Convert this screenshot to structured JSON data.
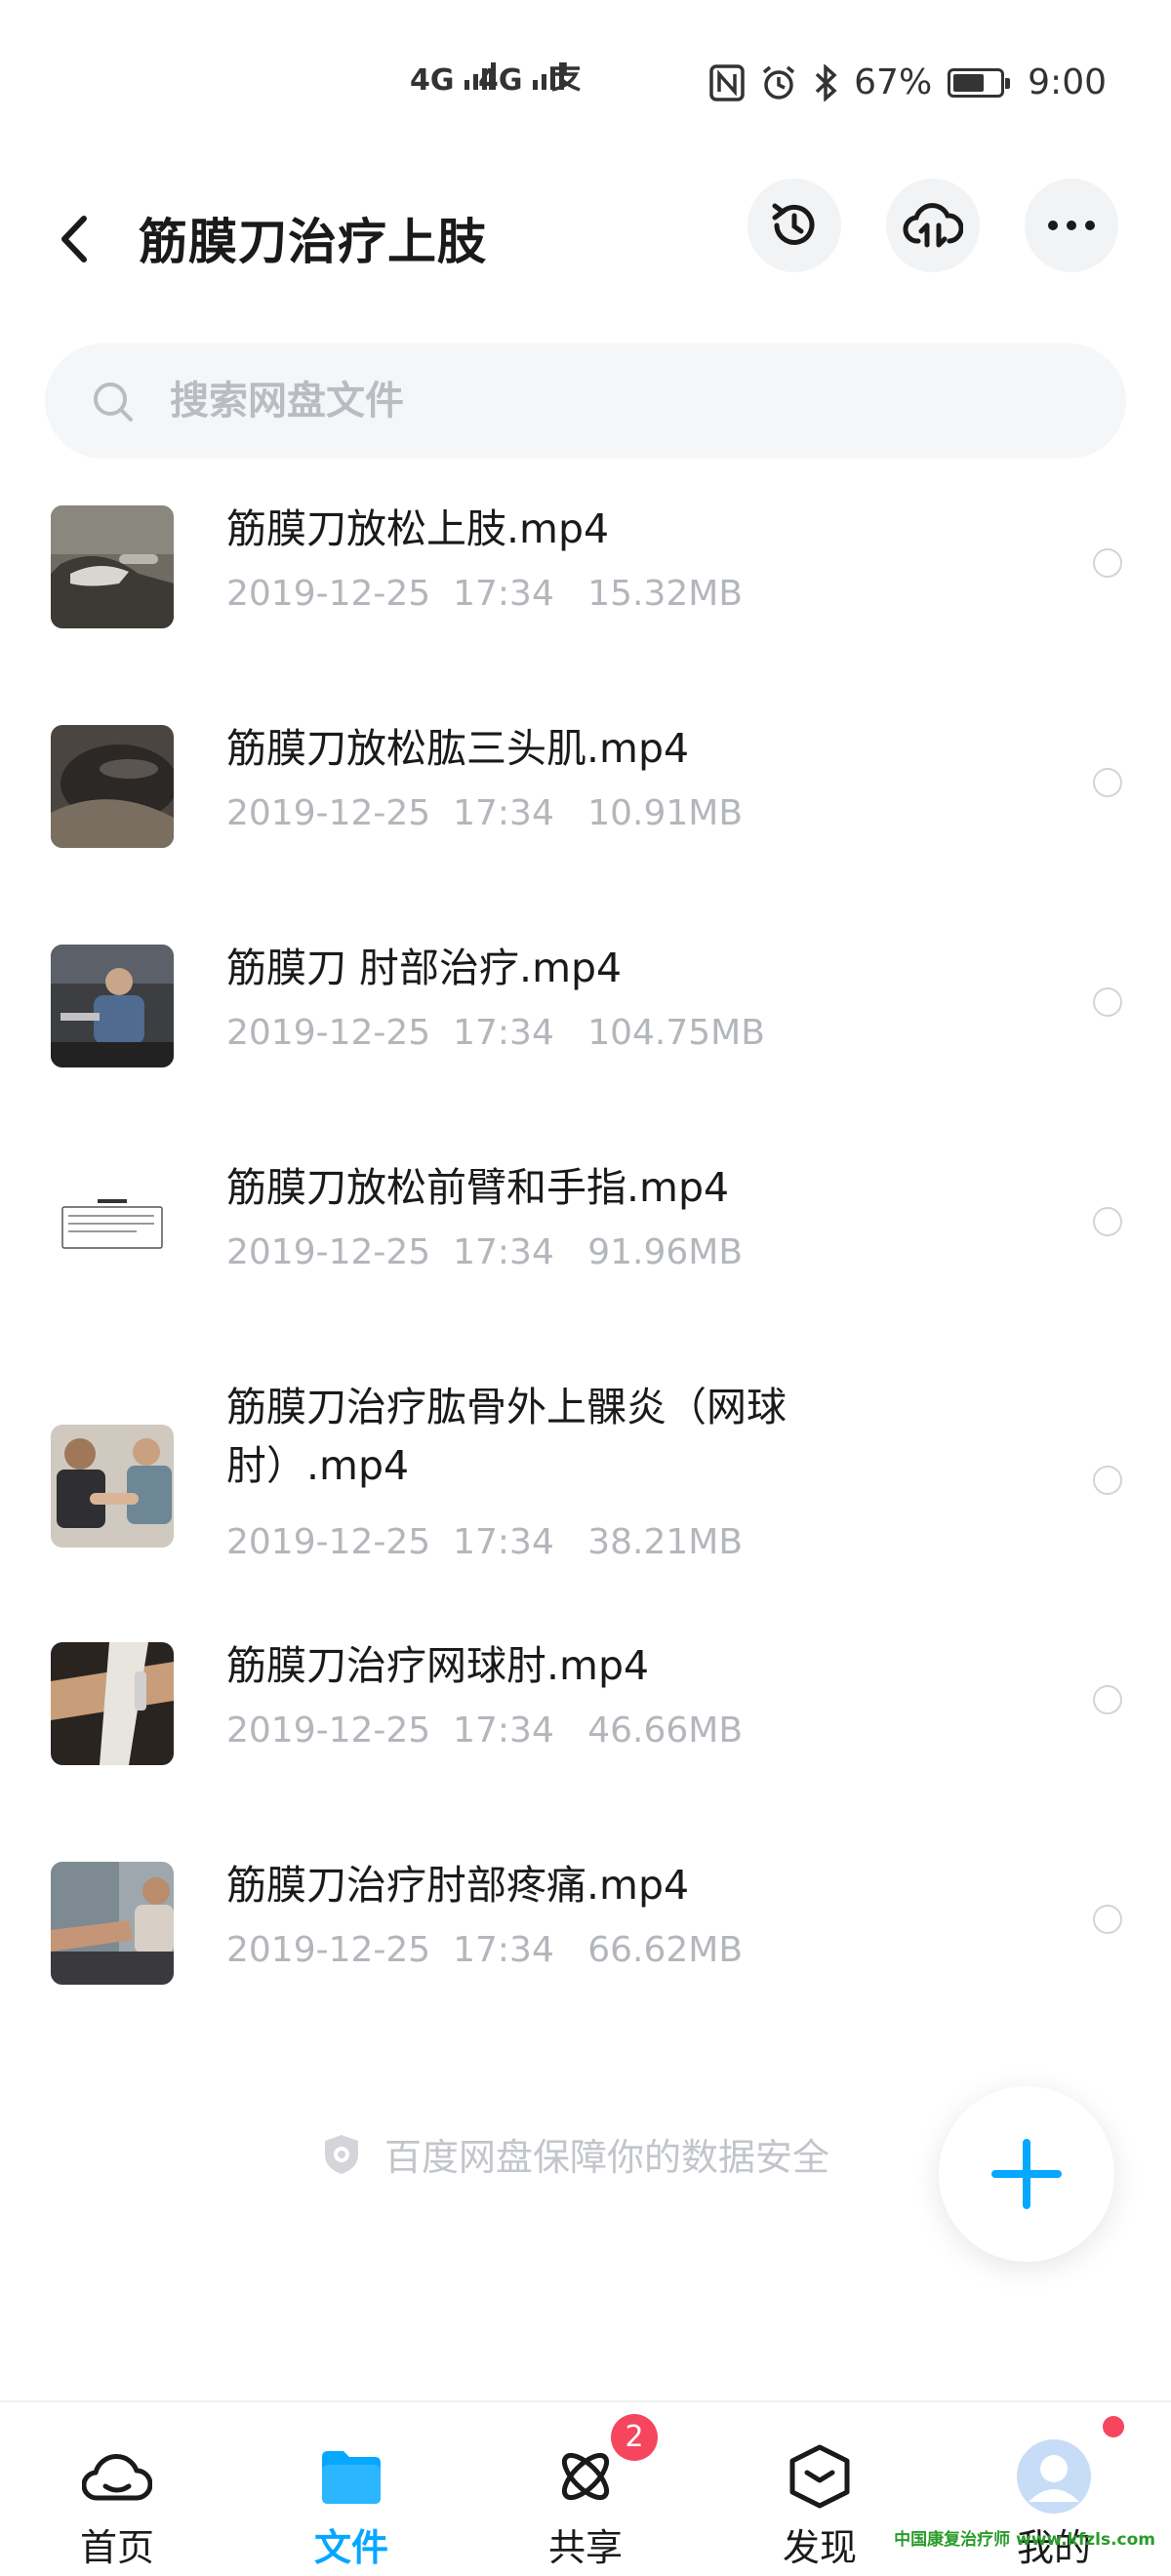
{
  "status_bar": {
    "signal1": "4G",
    "signal2": "4G",
    "battery": "67%",
    "time": "9:00"
  },
  "header": {
    "title": "筋膜刀治疗上肢"
  },
  "search": {
    "placeholder": "搜索网盘文件"
  },
  "files": [
    {
      "name": "筋膜刀放松上肢.mp4",
      "date": "2019-12-25",
      "time": "17:34",
      "size": "15.32MB"
    },
    {
      "name": "筋膜刀放松肱三头肌.mp4",
      "date": "2019-12-25",
      "time": "17:34",
      "size": "10.91MB"
    },
    {
      "name": "筋膜刀 肘部治疗.mp4",
      "date": "2019-12-25",
      "time": "17:34",
      "size": "104.75MB"
    },
    {
      "name": "筋膜刀放松前臂和手指.mp4",
      "date": "2019-12-25",
      "time": "17:34",
      "size": "91.96MB"
    },
    {
      "name": "筋膜刀治疗肱骨外上髁炎（网球肘）.mp4",
      "date": "2019-12-25",
      "time": "17:34",
      "size": "38.21MB"
    },
    {
      "name": "筋膜刀治疗网球肘.mp4",
      "date": "2019-12-25",
      "time": "17:34",
      "size": "46.66MB"
    },
    {
      "name": "筋膜刀治疗肘部疼痛.mp4",
      "date": "2019-12-25",
      "time": "17:34",
      "size": "66.62MB"
    }
  ],
  "footer_note": "百度网盘保障你的数据安全",
  "bottom_nav": {
    "items": [
      {
        "label": "首页",
        "icon": "cloud-home-icon"
      },
      {
        "label": "文件",
        "icon": "folder-icon"
      },
      {
        "label": "共享",
        "icon": "share-atom-icon",
        "badge": "2"
      },
      {
        "label": "发现",
        "icon": "discover-box-icon"
      },
      {
        "label": "我的",
        "icon": "avatar-icon"
      }
    ]
  },
  "watermark": "中国康复治疗师 www.kfzls.com",
  "colors": {
    "accent": "#06a7ff",
    "badge": "#f5465e",
    "meta_text": "#b3b6bb"
  }
}
